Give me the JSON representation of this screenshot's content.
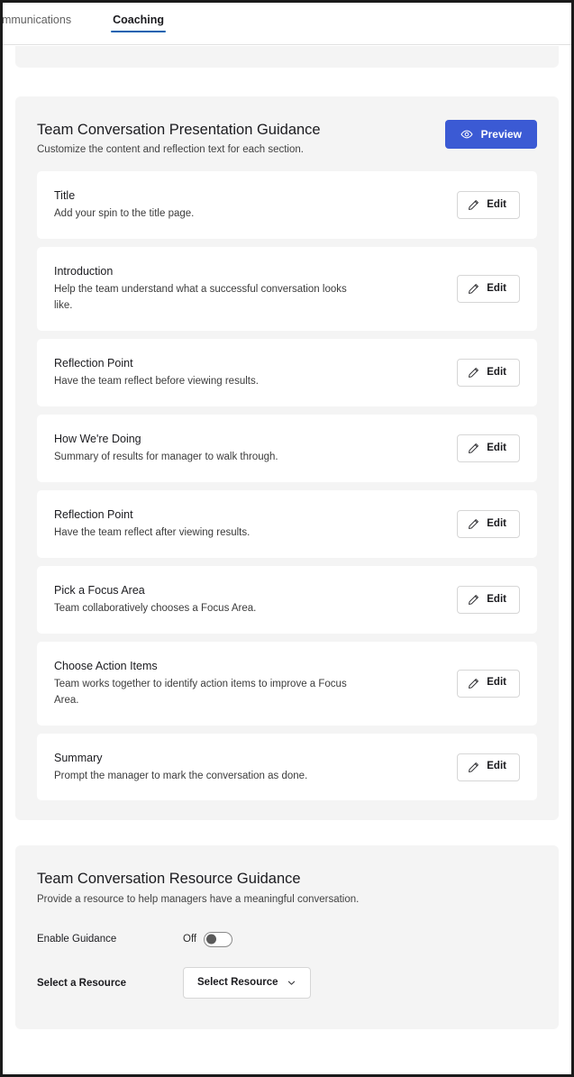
{
  "tabs": [
    {
      "label": "ommunications",
      "active": false,
      "name": "tab-communications"
    },
    {
      "label": "Coaching",
      "active": true,
      "name": "tab-coaching"
    }
  ],
  "colors": {
    "accent_blue": "#3b5ad4",
    "tab_underline": "#0f62b0",
    "card_bg": "#f4f4f4",
    "row_bg": "#ffffff",
    "border": "#d6d6d6"
  },
  "presentation_card": {
    "title": "Team Conversation Presentation Guidance",
    "subtitle": "Customize the content and reflection text for each section.",
    "preview_button": {
      "label": "Preview",
      "icon": "eye-icon"
    },
    "edit_button_label": "Edit",
    "edit_button_icon": "pencil-icon",
    "sections": [
      {
        "title": "Title",
        "description": "Add your spin to the title page.",
        "edit_label": "Edit"
      },
      {
        "title": "Introduction",
        "description": "Help the team understand what a successful conversation looks like.",
        "edit_label": "Edit"
      },
      {
        "title": "Reflection Point",
        "description": "Have the team reflect before viewing results.",
        "edit_label": "Edit"
      },
      {
        "title": "How We're Doing",
        "description": "Summary of results for manager to walk through.",
        "edit_label": "Edit"
      },
      {
        "title": "Reflection Point",
        "description": "Have the team reflect after viewing results.",
        "edit_label": "Edit"
      },
      {
        "title": "Pick a Focus Area",
        "description": "Team collaboratively chooses a Focus Area.",
        "edit_label": "Edit"
      },
      {
        "title": "Choose Action Items",
        "description": "Team works together to identify action items to improve a Focus Area.",
        "edit_label": "Edit"
      },
      {
        "title": "Summary",
        "description": "Prompt the manager to mark the conversation as done.",
        "edit_label": "Edit"
      }
    ]
  },
  "resource_card": {
    "title": "Team Conversation Resource Guidance",
    "subtitle": "Provide a resource to help managers have a meaningful conversation.",
    "enable_guidance": {
      "label": "Enable Guidance",
      "state_label": "Off",
      "checked": false
    },
    "select_resource": {
      "label": "Select a Resource",
      "value": "Select Resource",
      "icon": "chevron-down-icon"
    }
  }
}
